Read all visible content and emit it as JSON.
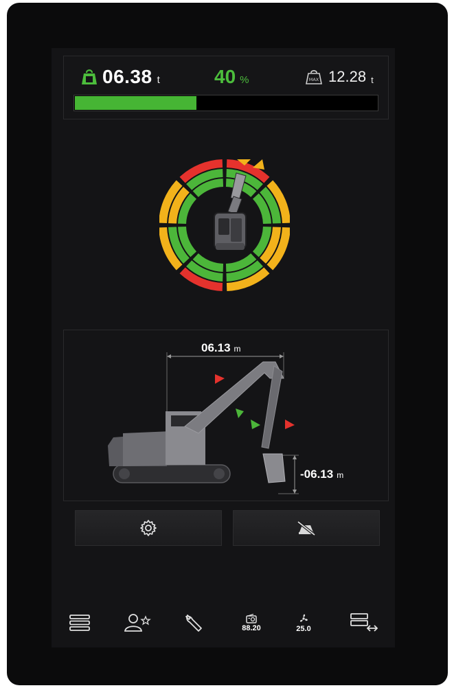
{
  "load": {
    "current_value": "06.38",
    "current_unit": "t",
    "percent_value": "40",
    "percent_unit": "%",
    "max_value": "12.28",
    "max_unit": "t",
    "max_icon_text": "MAX",
    "progress_fraction": 0.4
  },
  "dial": {
    "icon": "excavator-top-view-icon",
    "colors": {
      "red": "#e5322d",
      "yellow": "#f2b21b",
      "green": "#4cb63a"
    }
  },
  "side_view": {
    "reach_value": "06.13",
    "reach_unit": "m",
    "depth_value": "-06.13",
    "depth_unit": "m"
  },
  "buttons": {
    "settings_icon": "gear-icon",
    "mute_icon": "alarm-mute-icon"
  },
  "nav": {
    "items": [
      {
        "icon": "menu-icon"
      },
      {
        "icon": "user-favorite-icon"
      },
      {
        "icon": "wrench-icon"
      },
      {
        "icon": "radio-icon",
        "value": "88.20"
      },
      {
        "icon": "fan-icon",
        "value": "25.0"
      },
      {
        "icon": "switch-screen-icon"
      }
    ]
  },
  "colors": {
    "accent_green": "#4cbd3c",
    "background": "#141416"
  }
}
